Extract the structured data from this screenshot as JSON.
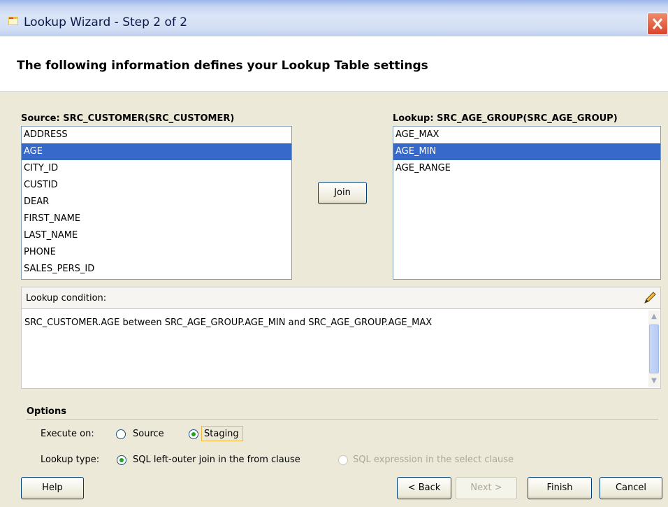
{
  "window": {
    "title": "Lookup Wizard - Step 2 of 2",
    "close_glyph": "✕"
  },
  "header": {
    "text": "The following information defines your Lookup Table settings"
  },
  "source": {
    "label": "Source: SRC_CUSTOMER(SRC_CUSTOMER)",
    "items": [
      "ADDRESS",
      "AGE",
      "CITY_ID",
      "CUSTID",
      "DEAR",
      "FIRST_NAME",
      "LAST_NAME",
      "PHONE",
      "SALES_PERS_ID"
    ],
    "selected": "AGE"
  },
  "lookup": {
    "label": "Lookup: SRC_AGE_GROUP(SRC_AGE_GROUP)",
    "items": [
      "AGE_MAX",
      "AGE_MIN",
      "AGE_RANGE"
    ],
    "selected": "AGE_MIN"
  },
  "join_button": "Join",
  "condition": {
    "label": "Lookup condition:",
    "text": "SRC_CUSTOMER.AGE between SRC_AGE_GROUP.AGE_MIN and SRC_AGE_GROUP.AGE_MAX"
  },
  "options": {
    "title": "Options",
    "execute_on": {
      "label": "Execute on:",
      "choices": [
        "Source",
        "Staging"
      ],
      "selected": "Staging"
    },
    "lookup_type": {
      "label": "Lookup type:",
      "choices": [
        "SQL left-outer join in the from clause",
        "SQL expression in the select clause"
      ],
      "selected": "SQL left-outer join in the from clause"
    }
  },
  "buttons": {
    "help": "Help",
    "back": "< Back",
    "next": "Next >",
    "finish": "Finish",
    "cancel": "Cancel"
  },
  "colors": {
    "selection": "#3669c9",
    "dialog_bg": "#ece9d8",
    "close_red": "#d9442a"
  }
}
